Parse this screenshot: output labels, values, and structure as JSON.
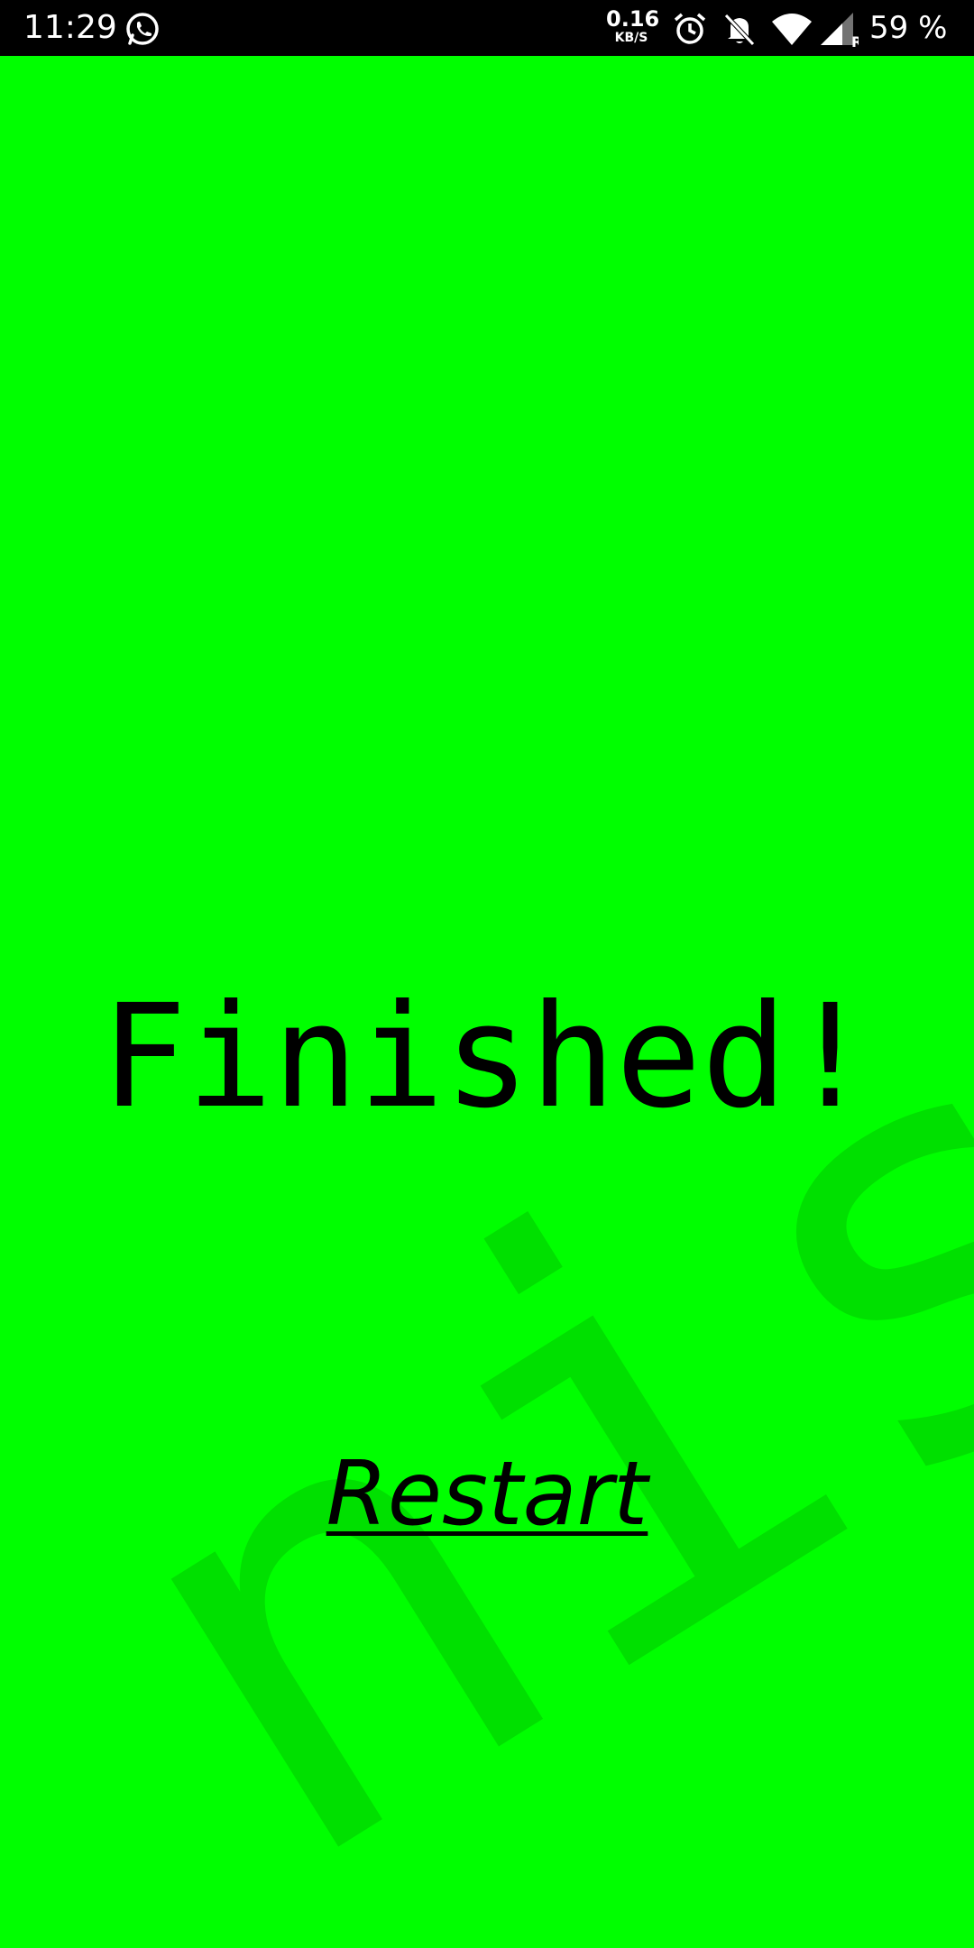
{
  "status_bar": {
    "time": "11:29",
    "net_speed_value": "0.16",
    "net_speed_unit": "KB/S",
    "battery": "59 %",
    "network_type": "R",
    "icons": [
      "whatsapp-icon",
      "alarm-icon",
      "bell-off-icon",
      "wifi-icon",
      "signal-icon"
    ]
  },
  "game": {
    "title": "Finished!",
    "watermark": "nishe",
    "restart_label": "Restart",
    "background_color": "#00ff00",
    "watermark_color": "#00e000",
    "text_color": "#000000"
  }
}
